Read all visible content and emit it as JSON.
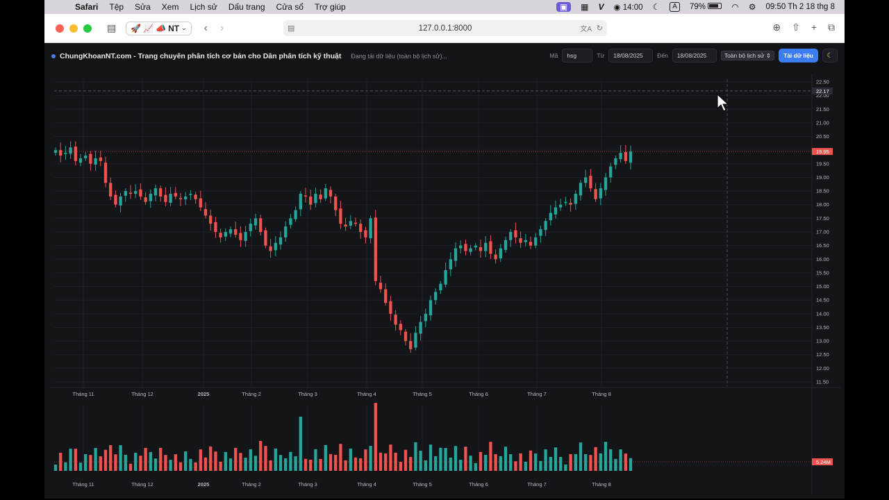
{
  "menubar": {
    "app_name": "Safari",
    "items": [
      "Tệp",
      "Sửa",
      "Xem",
      "Lịch sử",
      "Dấu trang",
      "Cửa sổ",
      "Trợ giúp"
    ],
    "timer": "14:00",
    "input_source": "A",
    "battery": "79%",
    "clock": "09:50 Th 2 18 thg 8"
  },
  "browser": {
    "tab_group": "NT",
    "url": "127.0.0.1:8000"
  },
  "app": {
    "title": "ChungKhoanNT.com - Trang chuyên phân tích cơ bản cho Dân phân tích kỹ thuật",
    "status": "Đang tải dữ liệu (toàn bộ lịch sử)...",
    "ticker_label": "Mã",
    "ticker_value": "hsg",
    "from_label": "Từ",
    "from_value": "18/08/2025",
    "to_label": "Đến",
    "to_value": "18/08/2025",
    "range_select": "Toàn bộ lịch sử",
    "load_button": "Tải dữ liệu",
    "theme_icon": "moon-icon"
  },
  "colors": {
    "up": "#26a69a",
    "down": "#ef5350",
    "accent": "#3b7ef4",
    "background": "#141519"
  },
  "chart_data": {
    "type": "candlestick",
    "price_axis": {
      "ticks": [
        "22.50",
        "22.00",
        "21.50",
        "21.00",
        "20.50",
        "20.00",
        "19.50",
        "19.00",
        "18.50",
        "18.00",
        "17.50",
        "17.00",
        "16.50",
        "16.00",
        "15.50",
        "15.00",
        "14.50",
        "14.00",
        "13.50",
        "13.00",
        "12.50",
        "12.00",
        "11.50"
      ],
      "range": [
        11.5,
        22.5
      ],
      "last_price": "19.95",
      "crosshair_price": "22.17"
    },
    "volume_axis": {
      "last_volume": "5.24M"
    },
    "time_axis": [
      "Tháng 11",
      "Tháng 12",
      "2025",
      "Tháng 2",
      "Tháng 3",
      "Tháng 4",
      "Tháng 5",
      "Tháng 6",
      "Tháng 7",
      "Tháng 8"
    ],
    "closes": [
      20.0,
      19.8,
      19.9,
      20.1,
      19.6,
      19.7,
      19.8,
      19.5,
      19.7,
      19.6,
      18.8,
      18.3,
      18.0,
      18.3,
      18.5,
      18.4,
      18.5,
      18.3,
      18.1,
      18.4,
      18.6,
      18.3,
      18.1,
      18.4,
      18.3,
      18.2,
      18.3,
      18.4,
      18.2,
      17.9,
      17.6,
      17.3,
      17.0,
      16.8,
      17.0,
      17.1,
      16.9,
      16.7,
      17.0,
      17.3,
      17.5,
      17.0,
      16.5,
      16.3,
      16.6,
      16.8,
      17.2,
      17.5,
      17.8,
      18.4,
      18.3,
      18.0,
      18.4,
      18.2,
      18.6,
      18.3,
      17.8,
      17.3,
      17.2,
      17.4,
      17.3,
      17.0,
      16.8,
      17.5,
      15.2,
      14.9,
      14.4,
      14.0,
      13.6,
      13.4,
      13.0,
      12.7,
      13.3,
      13.7,
      14.0,
      14.5,
      14.8,
      15.1,
      15.6,
      16.0,
      16.4,
      16.5,
      16.3,
      16.4,
      16.5,
      16.3,
      16.6,
      16.2,
      16.0,
      16.4,
      16.7,
      17.0,
      16.8,
      16.6,
      16.7,
      16.5,
      16.8,
      17.1,
      17.4,
      17.7,
      17.9,
      18.0,
      18.1,
      18.0,
      18.4,
      18.8,
      19.0,
      18.6,
      18.2,
      18.6,
      19.0,
      19.4,
      19.7,
      19.9,
      19.6,
      19.95
    ]
  }
}
